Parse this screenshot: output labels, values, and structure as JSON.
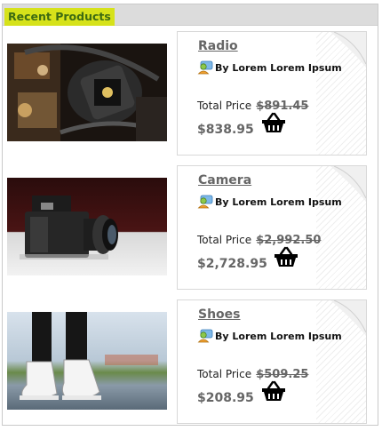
{
  "widget": {
    "title": "Recent Products"
  },
  "products": [
    {
      "name": "Radio",
      "by": "By Lorem Lorem Ipsum",
      "price_label": "Total Price",
      "old_price": "$891.45",
      "new_price": "$838.95"
    },
    {
      "name": "Camera",
      "by": "By Lorem Lorem Ipsum",
      "price_label": "Total Price",
      "old_price": "$2,992.50",
      "new_price": "$2,728.95"
    },
    {
      "name": "Shoes",
      "by": "By Lorem Lorem Ipsum",
      "price_label": "Total Price",
      "old_price": "$509.25",
      "new_price": "$208.95"
    }
  ],
  "icons": {
    "author": "user-icon",
    "cart": "basket-icon",
    "corner": "page-curl"
  },
  "colors": {
    "title_bg": "#d6e21a",
    "title_text": "#3d6b12",
    "price_text": "#666666"
  }
}
